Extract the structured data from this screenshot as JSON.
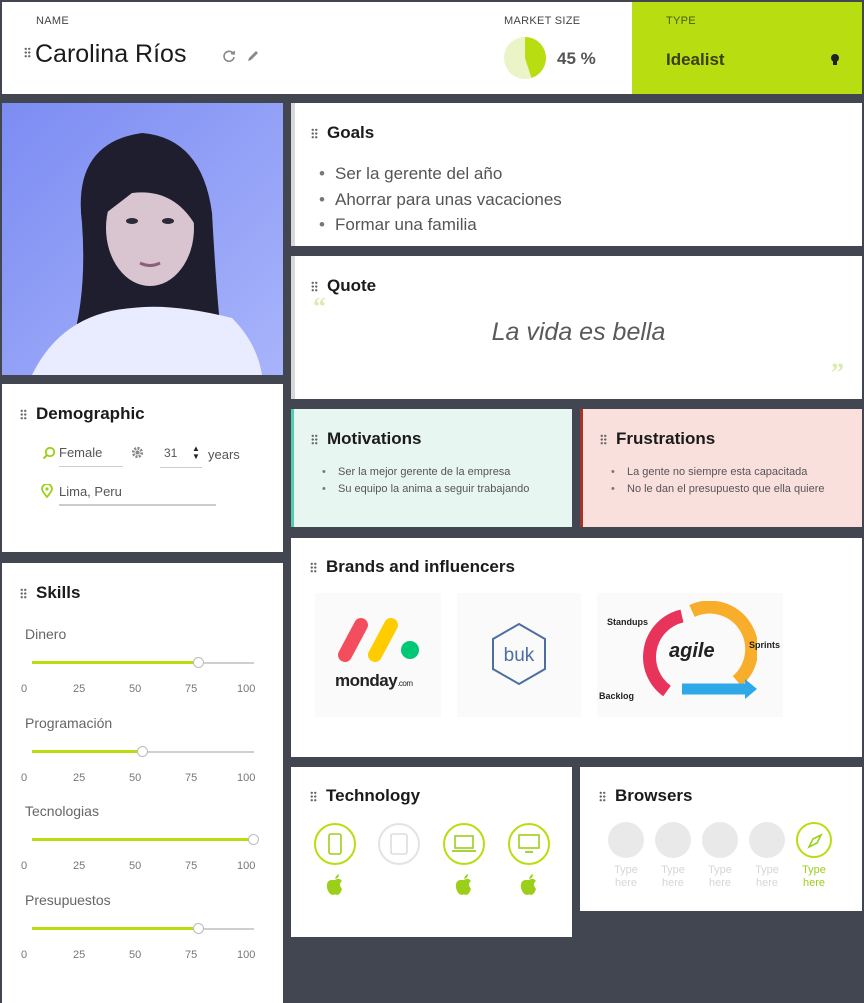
{
  "header": {
    "name_label": "NAME",
    "name": "Carolina Ríos",
    "market_label": "MARKET SIZE",
    "market_value": "45 %",
    "market_fraction": 0.45,
    "type_label": "TYPE",
    "type_value": "Idealist"
  },
  "goals": {
    "title": "Goals",
    "items": [
      "Ser la gerente del año",
      "Ahorrar para unas vacaciones",
      "Formar una familia"
    ]
  },
  "quote": {
    "title": "Quote",
    "text": "La vida es bella"
  },
  "demographic": {
    "title": "Demographic",
    "gender": "Female",
    "age": "31",
    "age_unit": "years",
    "location": "Lima, Peru"
  },
  "motivations": {
    "title": "Motivations",
    "items": [
      "Ser la mejor gerente de la empresa",
      "Su equipo la anima a seguir trabajando"
    ]
  },
  "frustrations": {
    "title": "Frustrations",
    "items": [
      "La gente no siempre esta capacitada",
      "No le dan el presupuesto que ella quiere"
    ]
  },
  "skills": {
    "title": "Skills",
    "ticks": [
      "0",
      "25",
      "50",
      "75",
      "100"
    ],
    "items": [
      {
        "label": "Dinero",
        "value": 75
      },
      {
        "label": "Programación",
        "value": 50
      },
      {
        "label": "Tecnologias",
        "value": 100
      },
      {
        "label": "Presupuestos",
        "value": 75
      }
    ]
  },
  "brands": {
    "title": "Brands and influencers",
    "monday": {
      "word": "monday",
      "suffix": ".com"
    },
    "buk": "buk",
    "agile": {
      "word": "agile",
      "standups": "Standups",
      "sprints": "Sprints",
      "backlog": "Backlog"
    }
  },
  "technology": {
    "title": "Technology"
  },
  "browsers": {
    "title": "Browsers",
    "labels": [
      "Type here",
      "Type here",
      "Type here",
      "Type here",
      "Type here"
    ]
  },
  "colors": {
    "accent": "#b8dd10",
    "motivation_bg": "#e8f6f1",
    "motivation_edge": "#55ccaa",
    "frustration_bg": "#fae0dd",
    "frustration_edge": "#a8322a",
    "background": "#424650"
  }
}
